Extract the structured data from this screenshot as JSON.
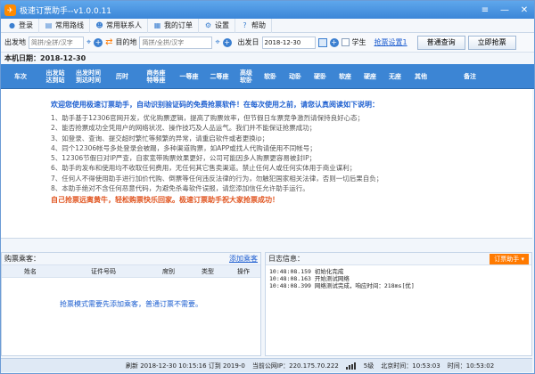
{
  "window": {
    "title": "极速订票助手--v1.0.0.11"
  },
  "menu": [
    {
      "label": "登录",
      "icon": "user-icon"
    },
    {
      "label": "常用路线",
      "icon": "route-icon"
    },
    {
      "label": "常用联系人",
      "icon": "contacts-icon"
    },
    {
      "label": "我的订单",
      "icon": "order-icon"
    },
    {
      "label": "设置",
      "icon": "gear-icon"
    },
    {
      "label": "帮助",
      "icon": "help-icon"
    }
  ],
  "search": {
    "from_label": "出发地",
    "from_placeholder": "简拼/全拼/汉字",
    "to_label": "目的地",
    "to_placeholder": "简拼/全拼/汉字",
    "date_label": "出发日",
    "date_value": "2018-12-30",
    "student_label": "学生",
    "settings_link": "抢票设置1",
    "query_button": "普通查询",
    "grab_button": "立即抢票"
  },
  "date_bar": "本机日期：2018-12-30",
  "columns": [
    "车次",
    "出发站\n达到站",
    "出发时间\n到达时间",
    "历时",
    "商务座\n特等座",
    "一等座",
    "二等座",
    "高级\n软卧",
    "软卧",
    "动卧",
    "硬卧",
    "软座",
    "硬座",
    "无座",
    "其他",
    "备注"
  ],
  "notice": {
    "head": "欢迎您使用极速订票助手，自动识别验证码的免费抢票软件！在每次使用之前，请您认真阅读如下说明：",
    "lines": [
      "1、助手基于12306官网开发，优化购票逻辑，提高了购票效率，但节假日车票竞争激烈请保持良好心态；",
      "2、能否抢票成功全凭用户的网络状况、操作技巧及人品运气。我们并不能保证抢票成功；",
      "3、如登录、查询、提交超时繁忙等频繁的异常，请重启软件或者更换ip；",
      "4、同个12306帐号多处登录会被踢，多种渠道购票，如APP或找人代购请使用不同帐号；",
      "5、12306节假日对IP严查，自家宽带购票效果更好，公司可能因多人购票更容易被封IP；",
      "6、助手的发布和使用均不收取任何费用，无任何其它售卖渠道。禁止任何人或任何实体用于商业谋利；",
      "7、任何人不得使用助手进行加价代购、倒票等任何违反法律的行为，勿触犯国家相关法律，否则一切后果自负；",
      "8、本助手绝对不含任何恶意代码，为避免杀毒软件误报，请您添加信任允许助手运行。"
    ],
    "foot": "自己抢票远离黄牛，轻松购票快乐回家。极速订票助手祝大家抢票成功！"
  },
  "passengers": {
    "title": "购票乘客：",
    "add_link": "添加乘客",
    "columns": [
      "姓名",
      "证件号码",
      "席别",
      "类型",
      "操作"
    ],
    "empty_text": "抢票模式需要先添加乘客，普通订票不需要。"
  },
  "log": {
    "title": "日志信息：",
    "assist_button": "订票助手 ▾",
    "lines": [
      "10:48:08.159 初始化完成",
      "10:48:08.163 开始测试网络",
      "10:48:08.399 网络测试完成，响应时间：218ms[优]"
    ]
  },
  "status": {
    "refresh_text": "刷新 2018-12-30 10:15:16 订到 2019-0",
    "ip_text": "当前公网IP：220.175.70.222",
    "level": "5级",
    "beijing_time": "北京时间：10:53:03",
    "local_time": "时间：10:53:02"
  }
}
